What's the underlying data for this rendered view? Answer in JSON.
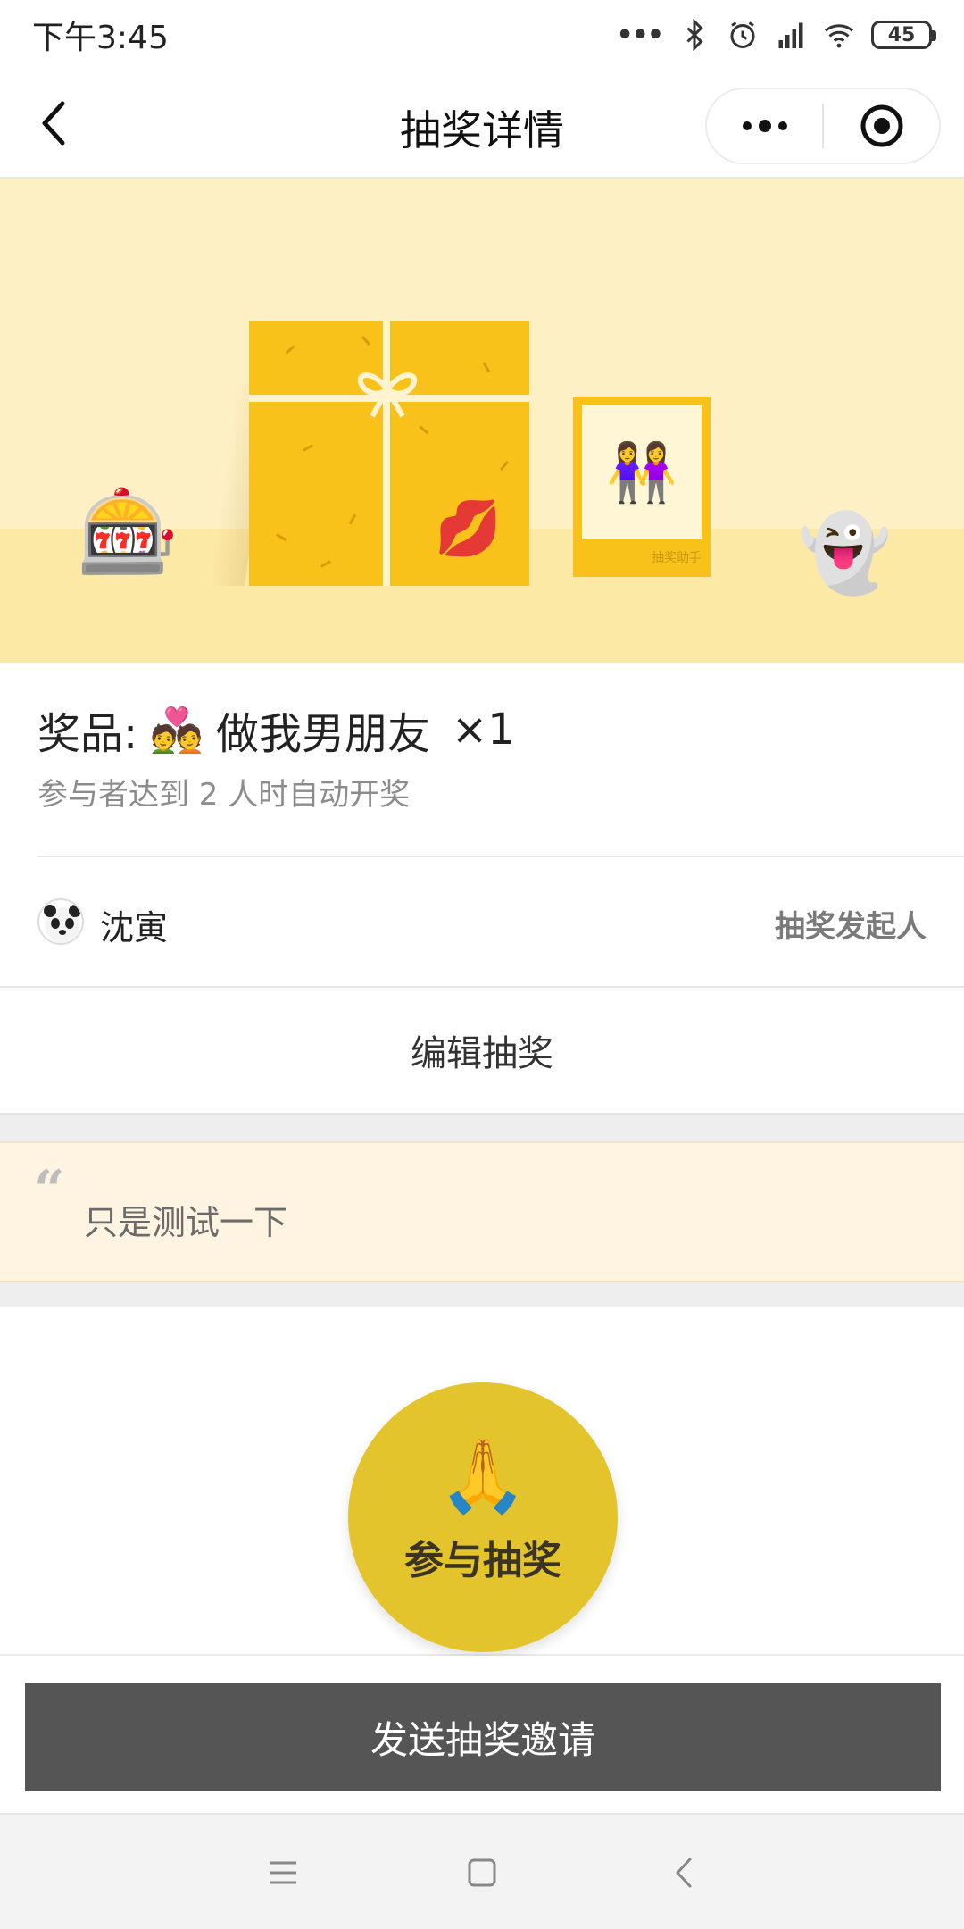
{
  "status_bar": {
    "time": "下午3:45",
    "dots": "•••",
    "battery": "45"
  },
  "nav": {
    "title": "抽奖详情",
    "more_label": "•••"
  },
  "banner": {
    "slot_emoji": "🎰",
    "ghost_emoji": "👻",
    "lips_emoji": "💋",
    "photo_emoji": "👭",
    "photo_caption": "抽奖助手"
  },
  "prize": {
    "label": "奖品:",
    "emoji": "💑",
    "name": "做我男朋友",
    "quantity": "×1",
    "condition": "参与者达到 2 人时自动开奖"
  },
  "organizer": {
    "avatar_emoji": "🐼",
    "name": "沈寅",
    "role": "抽奖发起人"
  },
  "edit": {
    "label": "编辑抽奖"
  },
  "note": {
    "quote_mark": "“",
    "text": "只是测试一下"
  },
  "participate": {
    "emoji": "🙏",
    "label": "参与抽奖"
  },
  "invite": {
    "label": "发送抽奖邀请"
  },
  "colors": {
    "banner_bg": "#fdf0c4",
    "gift_yellow": "#f8c21b",
    "join_button": "#e3c42c",
    "invite_button": "#555555",
    "note_bg": "#fef4e1"
  }
}
